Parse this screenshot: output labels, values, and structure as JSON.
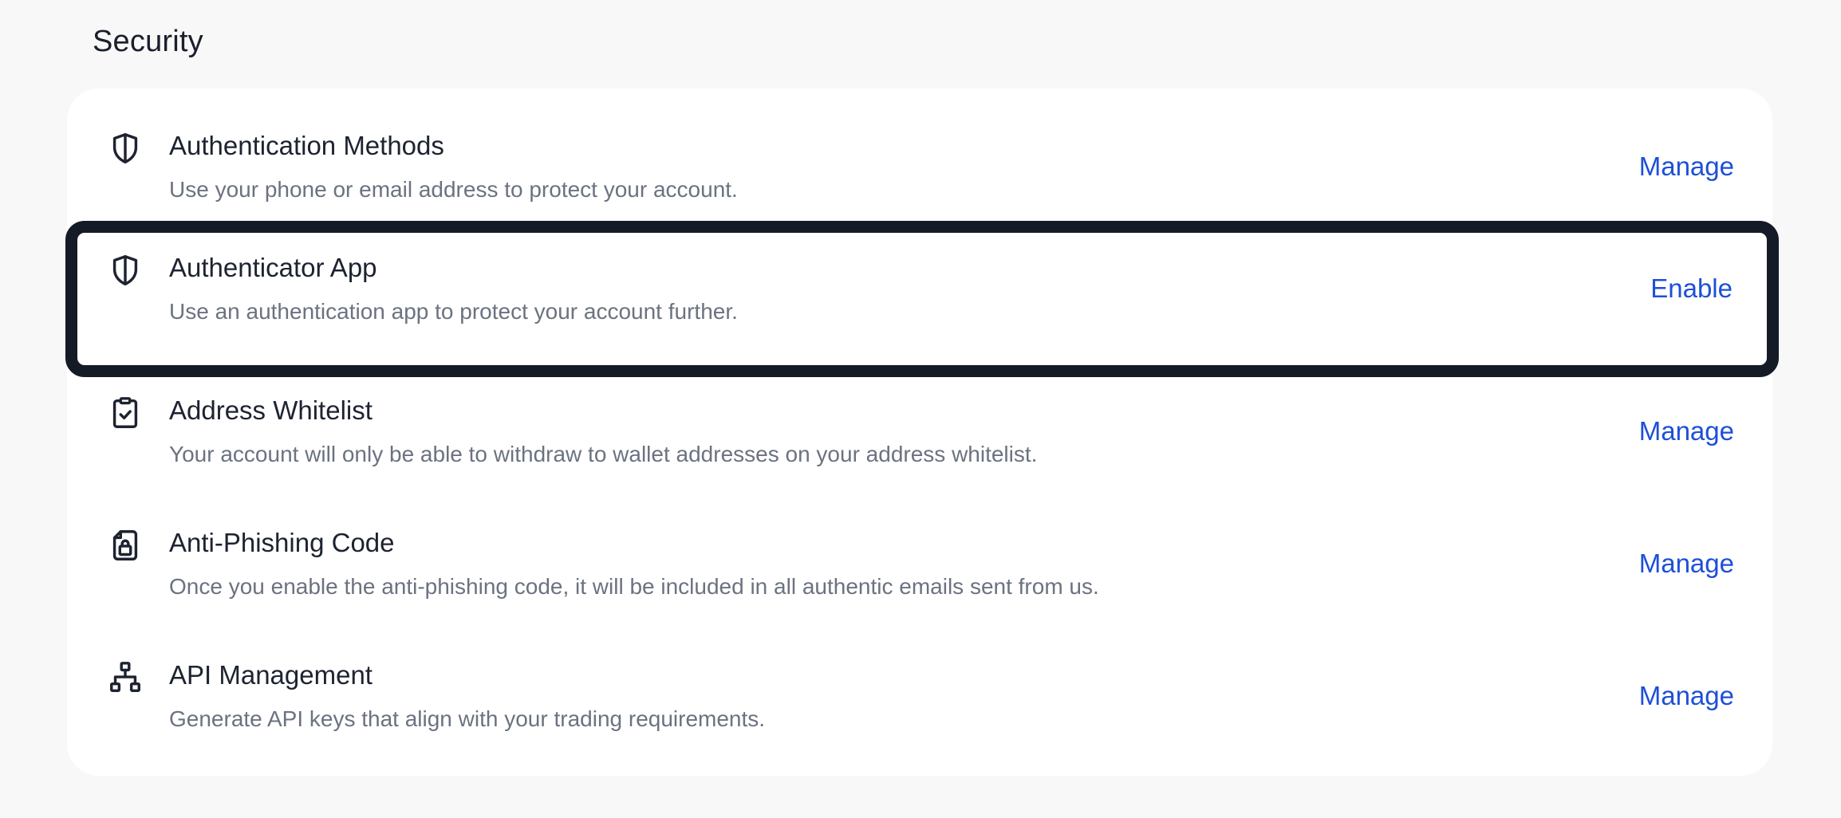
{
  "section": {
    "title": "Security"
  },
  "items": [
    {
      "title": "Authentication Methods",
      "description": "Use your phone or email address to protect your account.",
      "action": "Manage",
      "icon": "shield-icon"
    },
    {
      "title": "Authenticator App",
      "description": "Use an authentication app to protect your account further.",
      "action": "Enable",
      "icon": "shield-icon",
      "highlighted": true
    },
    {
      "title": "Address Whitelist",
      "description": "Your account will only be able to withdraw to wallet addresses on your address whitelist.",
      "action": "Manage",
      "icon": "clipboard-check-icon"
    },
    {
      "title": "Anti-Phishing Code",
      "description": "Once you enable the anti-phishing code, it will be included in all authentic emails sent from us.",
      "action": "Manage",
      "icon": "document-lock-icon"
    },
    {
      "title": "API Management",
      "description": "Generate API keys that align with your trading requirements.",
      "action": "Manage",
      "icon": "network-icon"
    }
  ],
  "colors": {
    "background": "#f8f8f8",
    "card": "#ffffff",
    "title": "#1d2330",
    "description": "#6b7280",
    "action": "#1d4fd8",
    "highlight_border": "#141a26"
  }
}
